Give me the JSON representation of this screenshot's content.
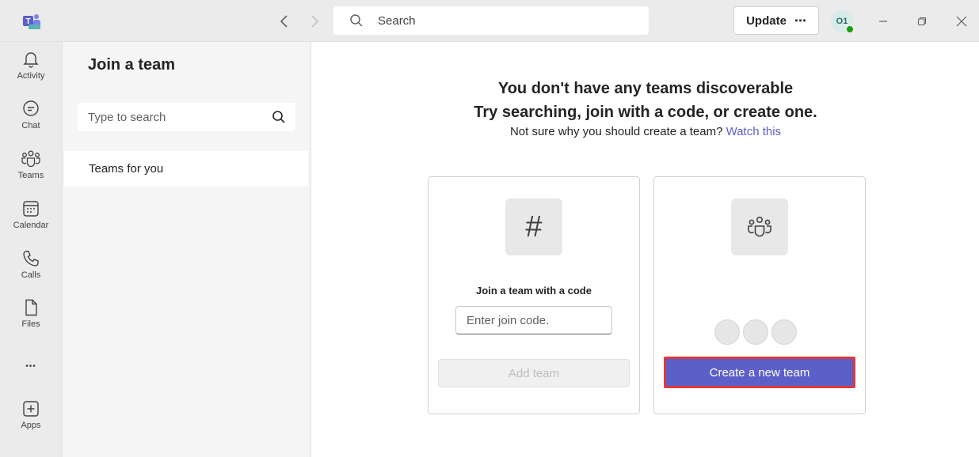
{
  "titlebar": {
    "search_placeholder": "Search",
    "update_label": "Update",
    "update_more": "⋯",
    "avatar_initials": "O1"
  },
  "rail": {
    "items": [
      {
        "label": "Activity",
        "icon": "bell-icon"
      },
      {
        "label": "Chat",
        "icon": "chat-icon"
      },
      {
        "label": "Teams",
        "icon": "teams-icon"
      },
      {
        "label": "Calendar",
        "icon": "calendar-icon"
      },
      {
        "label": "Calls",
        "icon": "phone-icon"
      },
      {
        "label": "Files",
        "icon": "file-icon"
      },
      {
        "label": "Apps",
        "icon": "plus-square-icon"
      }
    ],
    "more": "•••"
  },
  "panel": {
    "title": "Join a team",
    "search_placeholder": "Type to search",
    "item": "Teams for you"
  },
  "main": {
    "heading_line1": "You don't have any teams discoverable",
    "heading_line2": "Try searching, join with a code, or create one.",
    "subline": "Not sure why you should create a team?",
    "watch_link": "Watch this",
    "join_card": {
      "icon_glyph": "#",
      "label": "Join a team with a code",
      "input_placeholder": "Enter join code.",
      "button": "Add team"
    },
    "create_card": {
      "button": "Create a new team"
    }
  },
  "colors": {
    "accent": "#5b5fc7",
    "highlight_border": "#e0383e",
    "presence": "#13a10e"
  }
}
